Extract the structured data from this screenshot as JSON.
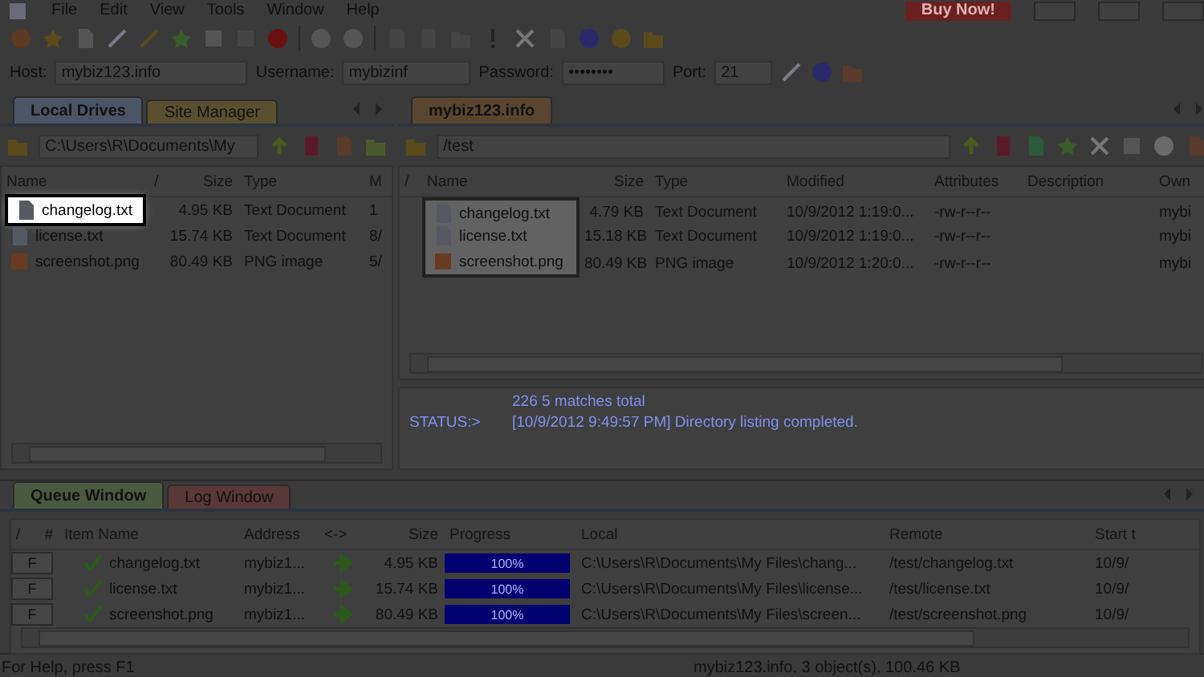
{
  "menu": [
    "File",
    "Edit",
    "View",
    "Tools",
    "Window",
    "Help"
  ],
  "buy_button": "Buy Now!",
  "connection": {
    "host_label": "Host:",
    "host": "mybiz123.info",
    "username_label": "Username:",
    "username": "mybizinf",
    "password_label": "Password:",
    "password": "••••••••",
    "port_label": "Port:",
    "port": "21"
  },
  "local": {
    "tabs": [
      {
        "label": "Local Drives",
        "selected": true
      },
      {
        "label": "Site Manager",
        "selected": false
      }
    ],
    "path": "C:\\Users\\R\\Documents\\My",
    "columns": [
      "Name",
      "/",
      "Size",
      "Type",
      "M"
    ],
    "rows": [
      {
        "kind": "text",
        "name": "changelog.txt",
        "size": "4.95 KB",
        "type": "Text Document",
        "modified": "1",
        "highlighted": true
      },
      {
        "kind": "text",
        "name": "license.txt",
        "size": "15.74 KB",
        "type": "Text Document",
        "modified": "8/",
        "highlighted": false
      },
      {
        "kind": "image",
        "name": "screenshot.png",
        "size": "80.49 KB",
        "type": "PNG image",
        "modified": "5/",
        "highlighted": false
      }
    ]
  },
  "remote": {
    "tabs": [
      {
        "label": "mybiz123.info",
        "selected": true
      }
    ],
    "path": "/test",
    "columns": [
      "/",
      "Name",
      "Size",
      "Type",
      "Modified",
      "Attributes",
      "Description",
      "Own"
    ],
    "rows": [
      {
        "kind": "text",
        "name": "changelog.txt",
        "size": "4.79 KB",
        "type": "Text Document",
        "modified": "10/9/2012 1:19:0...",
        "attributes": "-rw-r--r--",
        "owner": "mybi",
        "highlighted": true
      },
      {
        "kind": "text",
        "name": "license.txt",
        "size": "15.18 KB",
        "type": "Text Document",
        "modified": "10/9/2012 1:19:0...",
        "attributes": "-rw-r--r--",
        "owner": "mybi",
        "highlighted": true
      },
      {
        "kind": "image",
        "name": "screenshot.png",
        "size": "80.49 KB",
        "type": "PNG image",
        "modified": "10/9/2012 1:20:0...",
        "attributes": "-rw-r--r--",
        "owner": "mybi",
        "highlighted": true
      }
    ],
    "log": [
      {
        "text": "226 5 matches total"
      },
      {
        "prefix": "STATUS:>",
        "text": "[10/9/2012 9:49:57 PM] Directory listing completed."
      }
    ]
  },
  "queue": {
    "tabs": [
      {
        "label": "Queue Window",
        "selected": true
      },
      {
        "label": "Log Window",
        "selected": false
      }
    ],
    "columns": [
      "/",
      "#",
      "Item Name",
      "Address",
      "<->",
      "Size",
      "Progress",
      "Local",
      "Remote",
      "Start t"
    ],
    "rows": [
      {
        "flag": "F",
        "done": true,
        "name": "changelog.txt",
        "address": "mybiz1...",
        "size": "4.95 KB",
        "level": 1,
        "progress": "100%",
        "local": "C:\\Users\\R\\Documents\\My Files\\chang...",
        "remote": "/test/changelog.txt",
        "start": "10/9/"
      },
      {
        "flag": "F",
        "done": true,
        "name": "license.txt",
        "address": "mybiz1...",
        "size": "15.74 KB",
        "level": 1,
        "progress": "100%",
        "local": "C:\\Users\\R\\Documents\\My Files\\license...",
        "remote": "/test/license.txt",
        "start": "10/9/"
      },
      {
        "flag": "F",
        "done": true,
        "name": "screenshot.png",
        "address": "mybiz1...",
        "size": "80.49 KB",
        "level": 1,
        "progress": "100%",
        "local": "C:\\Users\\R\\Documents\\My Files\\screen...",
        "remote": "/test/screenshot.png",
        "start": "10/9/"
      }
    ]
  },
  "status_bar": [
    "For Help, press F1",
    "mybiz123.info, 3 object(s), 100.46 KB"
  ]
}
